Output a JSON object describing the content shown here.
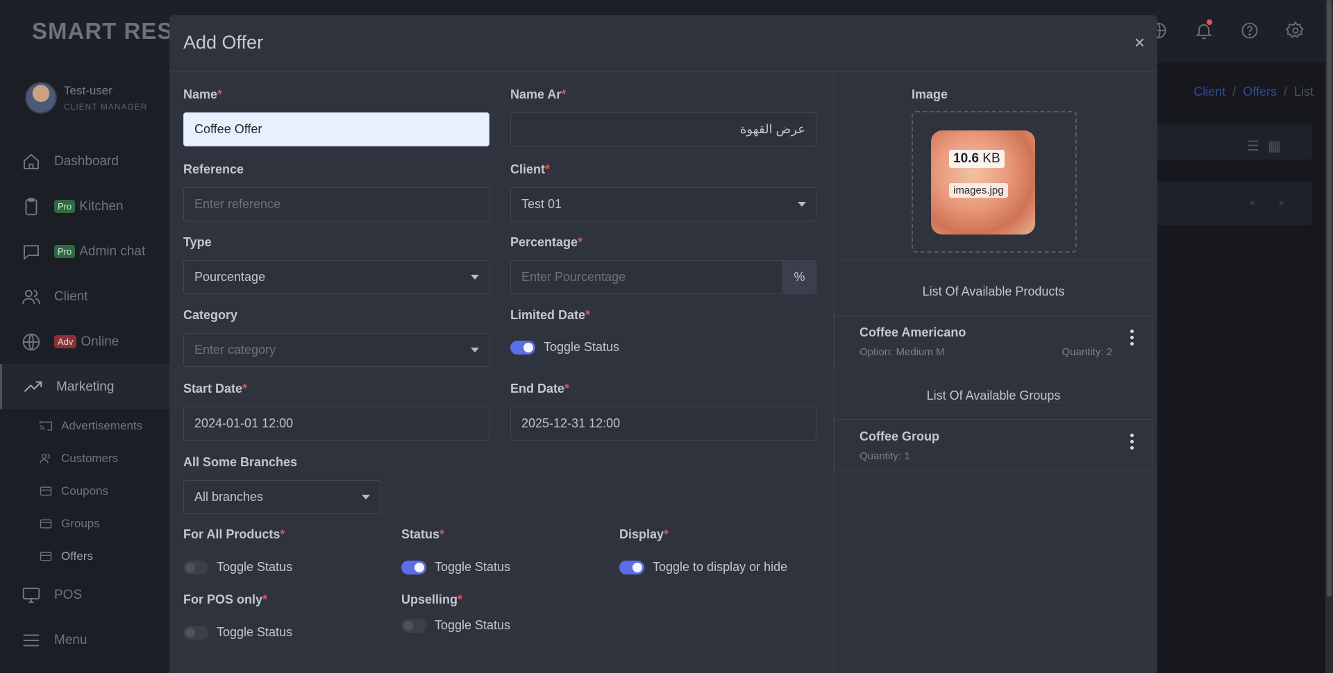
{
  "app": {
    "brand": "SMART REST"
  },
  "user": {
    "name": "Test-user",
    "role": "CLIENT MANAGER"
  },
  "nav": {
    "items": [
      {
        "label": "Dashboard",
        "icon": "home-icon"
      },
      {
        "label": "Kitchen",
        "badge": "Pro",
        "icon": "clipboard-icon"
      },
      {
        "label": "Admin chat",
        "badge": "Pro",
        "icon": "chat-icon"
      },
      {
        "label": "Client",
        "icon": "users-icon"
      },
      {
        "label": "Online",
        "badge": "Adv",
        "icon": "globe-icon"
      },
      {
        "label": "Marketing",
        "icon": "trend-icon"
      },
      {
        "label": "POS",
        "icon": "monitor-icon"
      },
      {
        "label": "Menu",
        "icon": "menu-icon"
      }
    ],
    "sub_items": [
      {
        "label": "Advertisements",
        "icon": "cast-icon"
      },
      {
        "label": "Customers",
        "icon": "users-icon"
      },
      {
        "label": "Coupons",
        "icon": "card-icon"
      },
      {
        "label": "Groups",
        "icon": "card-icon"
      },
      {
        "label": "Offers",
        "icon": "card-icon"
      }
    ]
  },
  "breadcrumb": {
    "items": [
      "Client",
      "Offers",
      "List"
    ]
  },
  "pager": {
    "prev": "«",
    "next": "»"
  },
  "modal": {
    "title": "Add Offer",
    "close": "×",
    "fields": {
      "name": {
        "label": "Name",
        "value": "Coffee Offer"
      },
      "name_ar": {
        "label": "Name Ar",
        "value": "عرض القهوة"
      },
      "reference": {
        "label": "Reference",
        "placeholder": "Enter reference"
      },
      "client": {
        "label": "Client",
        "value": "Test 01"
      },
      "type": {
        "label": "Type",
        "value": "Pourcentage"
      },
      "percentage": {
        "label": "Percentage",
        "placeholder": "Enter Pourcentage",
        "addon": "%"
      },
      "category": {
        "label": "Category",
        "placeholder": "Enter category"
      },
      "limited_date": {
        "label": "Limited Date",
        "toggle_text": "Toggle Status",
        "on": true
      },
      "start_date": {
        "label": "Start Date",
        "value": "2024-01-01 12:00"
      },
      "end_date": {
        "label": "End Date",
        "value": "2025-12-31 12:00"
      },
      "branches": {
        "label": "All Some Branches",
        "value": "All branches"
      },
      "for_all_products": {
        "label": "For All Products",
        "toggle_text": "Toggle Status",
        "on": false
      },
      "status": {
        "label": "Status",
        "toggle_text": "Toggle Status",
        "on": true
      },
      "display": {
        "label": "Display",
        "toggle_text": "Toggle to display or hide",
        "on": true
      },
      "for_pos_only": {
        "label": "For POS only",
        "toggle_text": "Toggle Status",
        "on": false
      },
      "upselling": {
        "label": "Upselling",
        "toggle_text": "Toggle Status",
        "on": false
      }
    },
    "image": {
      "label": "Image",
      "size_value": "10.6",
      "size_unit": "KB",
      "file_name": "images.jpg"
    },
    "products": {
      "title": "List Of Available Products",
      "items": [
        {
          "name": "Coffee Americano",
          "option": "Option: Medium M",
          "quantity": "Quantity: 2"
        }
      ]
    },
    "groups": {
      "title": "List Of Available Groups",
      "items": [
        {
          "name": "Coffee Group",
          "quantity": "Quantity: 1"
        }
      ]
    }
  },
  "colors": {
    "accent": "#5b6ee6",
    "required": "#e0545a",
    "modal_bg": "#2f333e"
  }
}
